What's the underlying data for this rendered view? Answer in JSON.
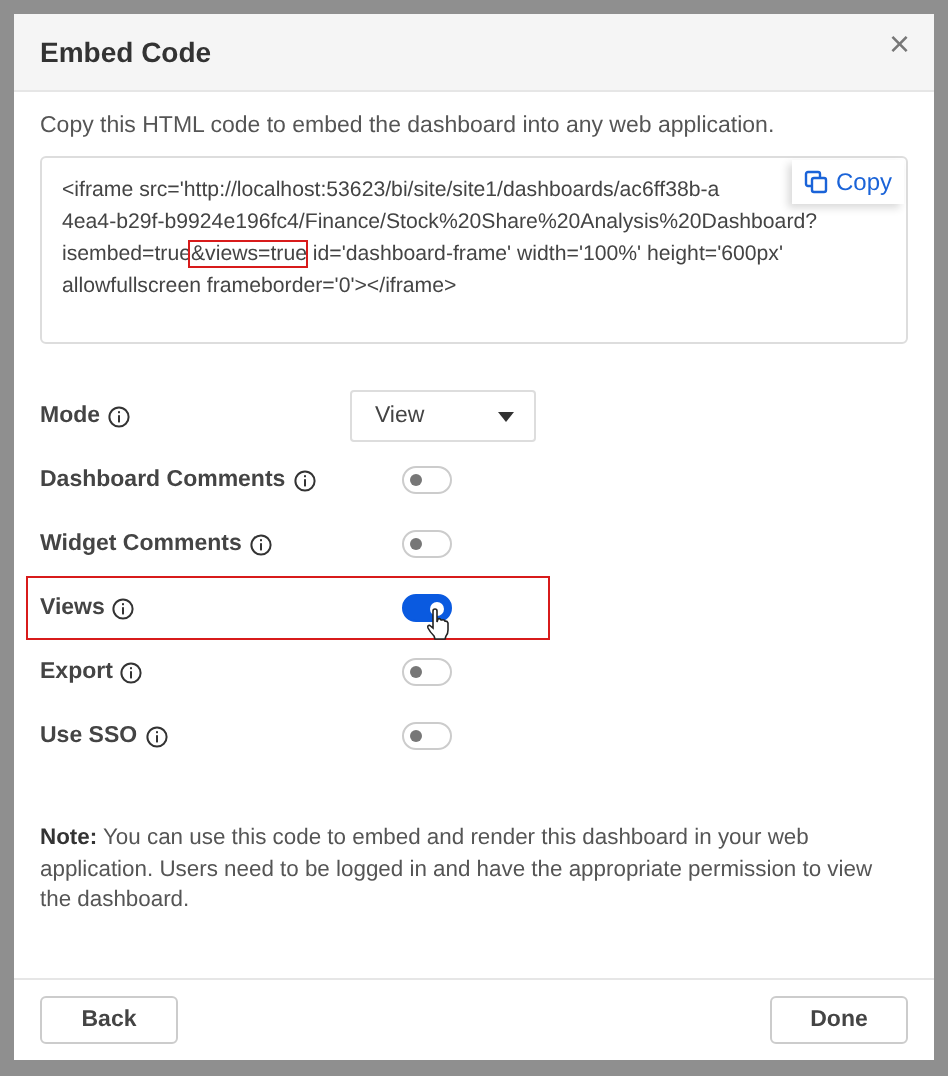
{
  "dialog": {
    "title": "Embed Code",
    "close": "×"
  },
  "description": "Copy this HTML code to embed the dashboard into any web application.",
  "code_lines": [
    [
      {
        "text": "<iframe src='http://localhost:53623/bi/site/site1/dashboards/ac6ff38b-a",
        "highlighted": false
      }
    ],
    [
      {
        "text": "4ea4-b29f-b9924e196fc4/Finance/Stock%20Share%20Analysis%20Dashboard?",
        "highlighted": false
      }
    ],
    [
      {
        "text": "isembed=true",
        "highlighted": false
      },
      {
        "text": "&views=true",
        "highlighted": true
      },
      {
        "text": " id='dashboard-frame' width='100%' height='600px'",
        "highlighted": false
      }
    ],
    [
      {
        "text": "allowfullscreen frameborder='0'></iframe>",
        "highlighted": false
      }
    ]
  ],
  "copy_button": "Copy",
  "settings": [
    {
      "kind": "dropdown",
      "label": "Mode",
      "value": "View",
      "highlighted": false
    },
    {
      "kind": "toggle",
      "label": "Dashboard Comments",
      "on": false,
      "highlighted": false
    },
    {
      "kind": "toggle",
      "label": "Widget Comments",
      "on": false,
      "highlighted": false
    },
    {
      "kind": "toggle",
      "label": "Views",
      "on": true,
      "highlighted": true
    },
    {
      "kind": "toggle",
      "label": "Export",
      "on": false,
      "highlighted": false
    },
    {
      "kind": "toggle",
      "label": "Use SSO",
      "on": false,
      "highlighted": false
    }
  ],
  "note": "**Note:** You can use this code to embed and render this dashboard in your web application. Users need to be logged in and have the appropriate permission to view the dashboard.",
  "buttons": {
    "back": "Back",
    "done": "Done"
  }
}
